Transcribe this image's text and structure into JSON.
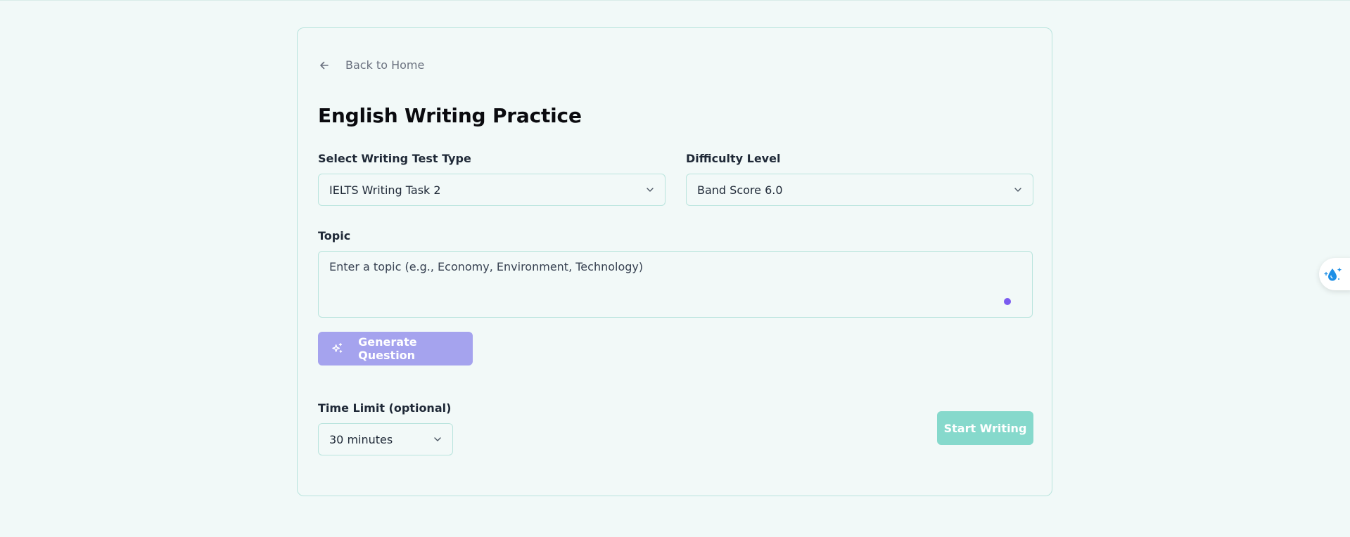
{
  "back_link": {
    "label": "Back to Home"
  },
  "page_title": "English Writing Practice",
  "test_type": {
    "label": "Select Writing Test Type",
    "value": "IELTS Writing Task 2"
  },
  "difficulty": {
    "label": "Difficulty Level",
    "value": "Band Score 6.0"
  },
  "topic": {
    "label": "Topic",
    "placeholder": "Enter a topic (e.g., Economy, Environment, Technology)"
  },
  "generate_button": {
    "label": "Generate Question"
  },
  "time_limit": {
    "label": "Time Limit (optional)",
    "value": "30 minutes"
  },
  "start_button": {
    "label": "Start Writing"
  },
  "colors": {
    "background": "#f1f9f8",
    "border": "#b9e4dd",
    "generate_button": "#a5a3ee",
    "start_button": "#86d9cc",
    "accent_dot": "#7b5cf0",
    "widget_icon": "#1e8fe6"
  },
  "icons": {
    "back": "arrow-left-icon",
    "chevron": "chevron-down-icon",
    "generate": "sparkles-icon",
    "widget": "water-drop-sparkle-icon"
  }
}
